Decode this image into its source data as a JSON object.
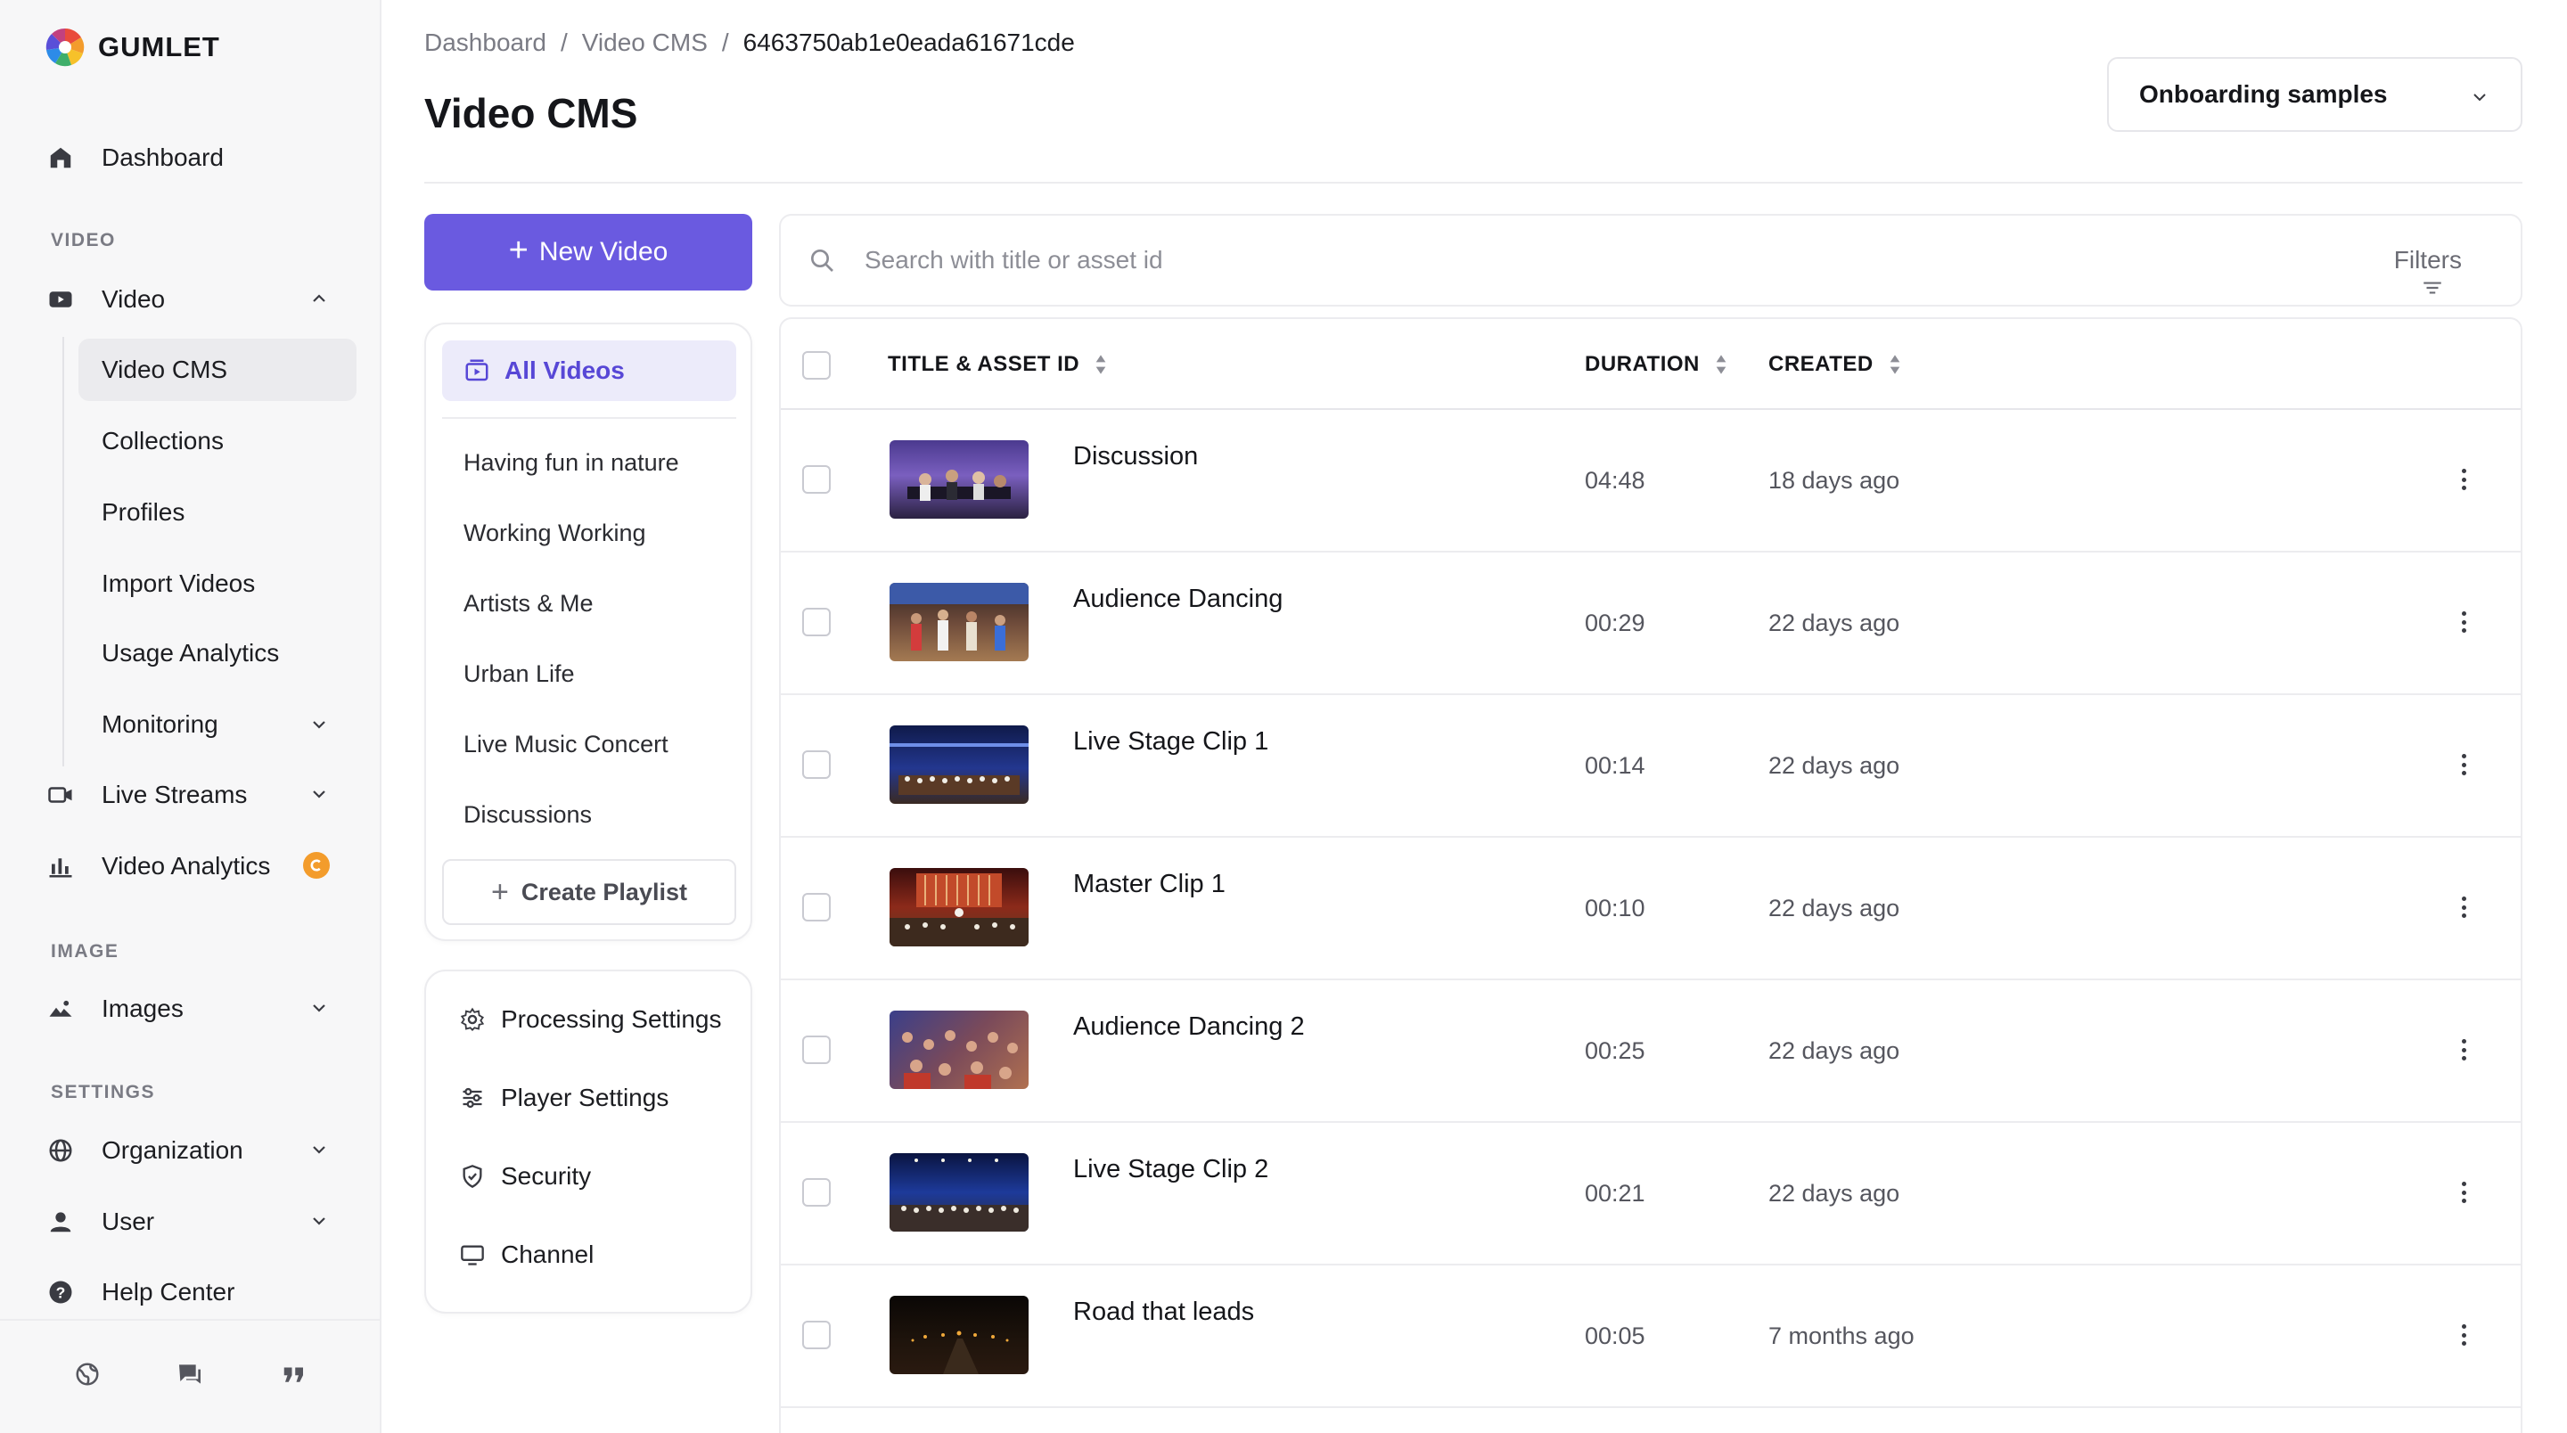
{
  "brand": {
    "name": "GUMLET"
  },
  "sidebar": {
    "dashboard": "Dashboard",
    "video_section": "VIDEO",
    "video": "Video",
    "video_sub": [
      "Video CMS",
      "Collections",
      "Profiles",
      "Import Videos",
      "Usage Analytics",
      "Monitoring"
    ],
    "live_streams": "Live Streams",
    "video_analytics": "Video Analytics",
    "image_section": "IMAGE",
    "images": "Images",
    "settings_section": "SETTINGS",
    "organization": "Organization",
    "user": "User",
    "help_center": "Help Center",
    "footer_icons": [
      "globe-icon",
      "chat-icon",
      "quote-icon"
    ]
  },
  "header": {
    "breadcrumb": [
      "Dashboard",
      "Video CMS",
      "6463750ab1e0eada61671cde"
    ],
    "title": "Video CMS",
    "workspace": "Onboarding samples"
  },
  "left_panel": {
    "new_video": "New Video",
    "all_videos": "All Videos",
    "playlists": [
      "Having fun in nature",
      "Working Working",
      "Artists & Me",
      "Urban Life",
      "Live Music Concert",
      "Discussions"
    ],
    "create_playlist": "Create Playlist",
    "settings": [
      "Processing Settings",
      "Player Settings",
      "Security",
      "Channel"
    ]
  },
  "search": {
    "placeholder": "Search with title or asset id",
    "filters": "Filters"
  },
  "table": {
    "columns": [
      "TITLE & ASSET ID",
      "DURATION",
      "CREATED"
    ],
    "rows": [
      {
        "title": "Discussion",
        "duration": "04:48",
        "created": "18 days ago"
      },
      {
        "title": "Audience Dancing",
        "duration": "00:29",
        "created": "22 days ago"
      },
      {
        "title": "Live Stage Clip 1",
        "duration": "00:14",
        "created": "22 days ago"
      },
      {
        "title": "Master Clip 1",
        "duration": "00:10",
        "created": "22 days ago"
      },
      {
        "title": "Audience Dancing 2",
        "duration": "00:25",
        "created": "22 days ago"
      },
      {
        "title": "Live Stage Clip 2",
        "duration": "00:21",
        "created": "22 days ago"
      },
      {
        "title": "Road that leads",
        "duration": "00:05",
        "created": "7 months ago"
      }
    ]
  },
  "colors": {
    "accent": "#6a5ae0",
    "active_bg": "#ecebfa",
    "badge": "#f39c2c"
  }
}
